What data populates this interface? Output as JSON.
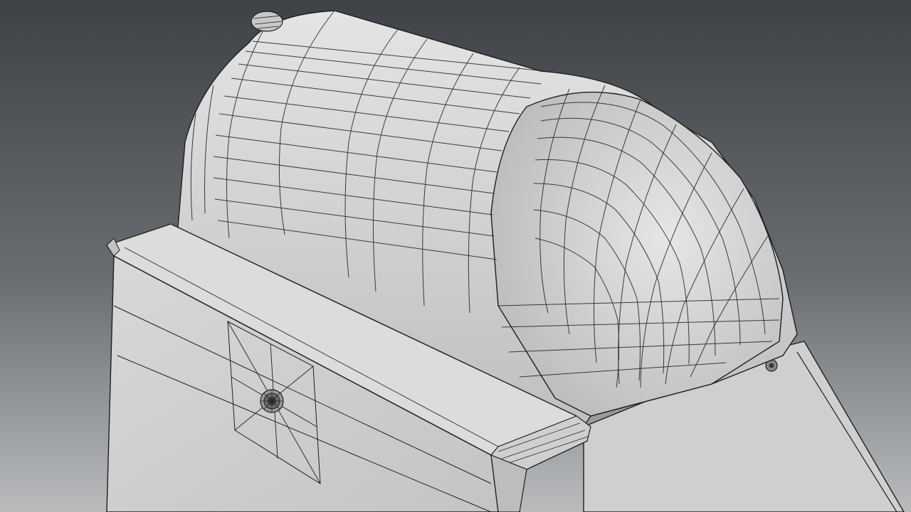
{
  "scene": {
    "subject": "wireframe-render",
    "colors": {
      "background_top": "#3e4246",
      "background_bottom": "#b9bbbd",
      "surface_light": "#dedede",
      "surface_mid": "#c9c9c9",
      "surface_dark": "#a9a9a9",
      "wire": "#1e1e1e"
    }
  }
}
